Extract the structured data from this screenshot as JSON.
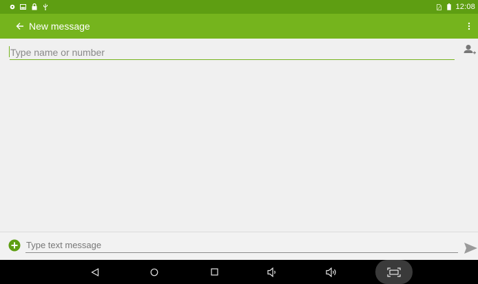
{
  "status_bar": {
    "time": "12:08",
    "left_icons": [
      "settings-notification-icon",
      "image-notification-icon",
      "lock-icon",
      "usb-icon"
    ],
    "right_icons": [
      "no-sim-icon",
      "battery-icon"
    ]
  },
  "app_bar": {
    "title": "New message",
    "back_icon": "arrow-back-icon",
    "overflow_icon": "more-vert-icon",
    "color": "#75b41d",
    "status_color": "#5e9e12"
  },
  "recipient": {
    "placeholder": "Type name or number",
    "value": "",
    "add_contact_icon": "add-person-icon"
  },
  "compose": {
    "placeholder": "Type text message",
    "value": "",
    "attach_icon": "add-circle-icon",
    "send_icon": "send-icon"
  },
  "nav_bar": {
    "buttons": [
      "back-icon",
      "home-icon",
      "recents-icon",
      "volume-down-icon",
      "volume-up-icon",
      "screenshot-icon"
    ]
  }
}
